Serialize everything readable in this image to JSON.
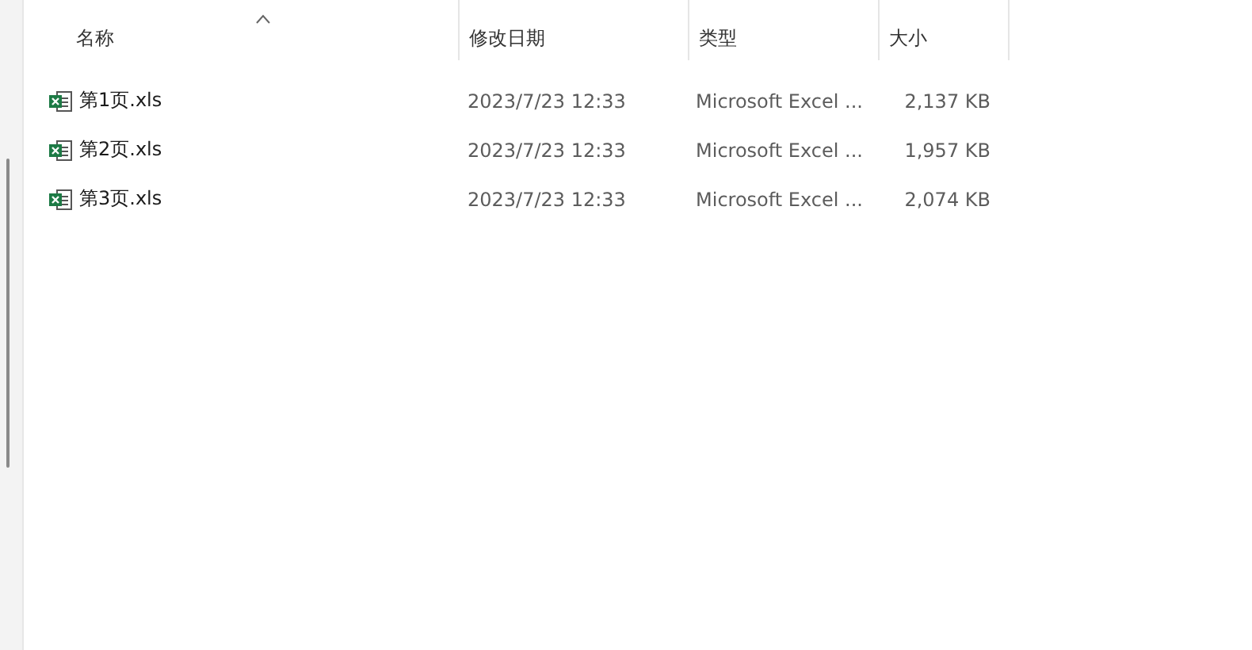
{
  "columns": [
    {
      "label": "名称",
      "sorted": true
    },
    {
      "label": "修改日期",
      "sorted": false
    },
    {
      "label": "类型",
      "sorted": false
    },
    {
      "label": "大小",
      "sorted": false
    }
  ],
  "files": [
    {
      "name": "第1页.xls",
      "modified": "2023/7/23 12:33",
      "type": "Microsoft Excel ...",
      "size": "2,137 KB"
    },
    {
      "name": "第2页.xls",
      "modified": "2023/7/23 12:33",
      "type": "Microsoft Excel ...",
      "size": "1,957 KB"
    },
    {
      "name": "第3页.xls",
      "modified": "2023/7/23 12:33",
      "type": "Microsoft Excel ...",
      "size": "2,074 KB"
    }
  ]
}
